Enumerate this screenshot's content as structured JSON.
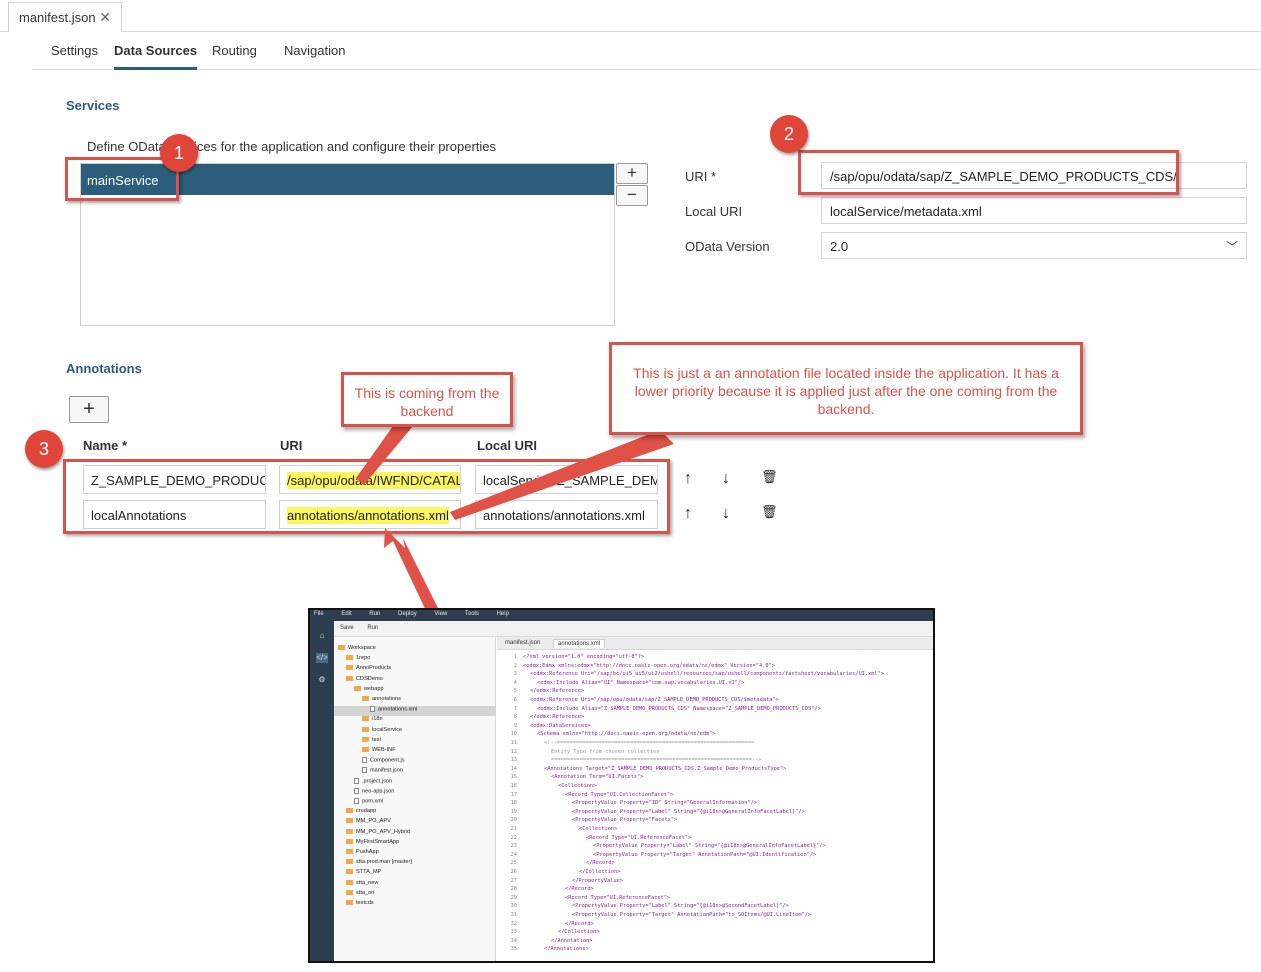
{
  "editor": {
    "file_tab": "manifest.json",
    "close_glyph": "✕"
  },
  "section_tabs": [
    "Settings",
    "Data Sources",
    "Routing",
    "Navigation"
  ],
  "services": {
    "heading": "Services",
    "description": "Define OData services for the application and configure their properties",
    "items": [
      "mainService"
    ],
    "add_label": "+",
    "remove_label": "−",
    "uri_label": "URI *",
    "uri_value": "/sap/opu/odata/sap/Z_SAMPLE_DEMO_PRODUCTS_CDS/",
    "local_uri_label": "Local URI",
    "local_uri_value": "localService/metadata.xml",
    "odata_version_label": "OData Version",
    "odata_version_value": "2.0"
  },
  "annotations": {
    "heading": "Annotations",
    "add_label": "+",
    "columns": [
      "Name *",
      "URI",
      "Local URI"
    ],
    "rows": [
      {
        "name": "Z_SAMPLE_DEMO_PRODUC",
        "uri": "/sap/opu/odata/IWFND/CATAL",
        "local_uri": "localService/Z_SAMPLE_DEM"
      },
      {
        "name": "localAnnotations",
        "uri": "annotations/annotations.xml",
        "local_uri": "annotations/annotations.xml"
      }
    ],
    "up_icon": "↑",
    "down_icon": "↓",
    "delete_icon": "🗑"
  },
  "callouts": {
    "badge_1": "1",
    "badge_2": "2",
    "badge_3": "3",
    "backend": "This is coming from the backend",
    "local": "This is just a an annotation file located inside the application. It has a lower priority because it is applied just after the one coming from the backend."
  },
  "colors": {
    "accent": "#2a5d7e",
    "selected_row": "#2c5e7c",
    "annotation_red": "#d9534a",
    "highlight": "#fbf75c"
  },
  "ide": {
    "menu": [
      "File",
      "Edit",
      "Run",
      "Deploy",
      "View",
      "Tools",
      "Help"
    ],
    "toolbar": [
      "Save",
      "Run"
    ],
    "tabs": [
      "manifest.json",
      "annotations.xml"
    ],
    "tree": [
      {
        "label": "Workspace",
        "depth": 0,
        "type": "folder"
      },
      {
        "label": "1repo",
        "depth": 1,
        "type": "folder"
      },
      {
        "label": "AnnoProducts",
        "depth": 1,
        "type": "folder"
      },
      {
        "label": "CDSDemo",
        "depth": 1,
        "type": "folder"
      },
      {
        "label": "webapp",
        "depth": 2,
        "type": "folder"
      },
      {
        "label": "annotations",
        "depth": 3,
        "type": "folder"
      },
      {
        "label": "annotations.xml",
        "depth": 4,
        "type": "doc",
        "selected": true
      },
      {
        "label": "i18n",
        "depth": 3,
        "type": "folder"
      },
      {
        "label": "localService",
        "depth": 3,
        "type": "folder"
      },
      {
        "label": "test",
        "depth": 3,
        "type": "folder"
      },
      {
        "label": "WEB-INF",
        "depth": 3,
        "type": "folder"
      },
      {
        "label": "Component.js",
        "depth": 3,
        "type": "doc"
      },
      {
        "label": "manifest.json",
        "depth": 3,
        "type": "doc"
      },
      {
        "label": ".project.json",
        "depth": 2,
        "type": "doc"
      },
      {
        "label": "neo-app.json",
        "depth": 2,
        "type": "doc"
      },
      {
        "label": "pom.xml",
        "depth": 2,
        "type": "doc"
      },
      {
        "label": "crudapp",
        "depth": 1,
        "type": "folder"
      },
      {
        "label": "MM_PO_APV",
        "depth": 1,
        "type": "folder"
      },
      {
        "label": "MM_PO_APV_Hybrid",
        "depth": 1,
        "type": "folder"
      },
      {
        "label": "MyFirstSmartApp",
        "depth": 1,
        "type": "folder"
      },
      {
        "label": "PushApp",
        "depth": 1,
        "type": "folder"
      },
      {
        "label": "stta.prod.man [master]",
        "depth": 1,
        "type": "folder"
      },
      {
        "label": "STTA_MP",
        "depth": 1,
        "type": "folder"
      },
      {
        "label": "stta_new",
        "depth": 1,
        "type": "folder"
      },
      {
        "label": "stta_ori",
        "depth": 1,
        "type": "folder"
      },
      {
        "label": "testcds",
        "depth": 1,
        "type": "folder"
      }
    ],
    "code": [
      {
        "n": "1",
        "indent": 0,
        "text": "<?xml version=\"1.0\" encoding=\"utf-8\"?>"
      },
      {
        "n": "2",
        "indent": 0,
        "text": "<edmx:Edmx xmlns:edmx=\"http://docs.oasis-open.org/odata/ns/edmx\" Version=\"4.0\">"
      },
      {
        "n": "3",
        "indent": 1,
        "text": "<edmx:Reference Uri=\"/sap/bc/ui5_ui5/ui2/ushell/resources/sap/ushell/components/factsheet/vocabularies/UI.xml\">"
      },
      {
        "n": "4",
        "indent": 2,
        "text": "<edmx:Include Alias=\"UI\" Namespace=\"com.sap.vocabularies.UI.v1\"/>"
      },
      {
        "n": "5",
        "indent": 1,
        "text": "</edmx:Reference>"
      },
      {
        "n": "6",
        "indent": 1,
        "text": "<edmx:Reference Uri=\"/sap/opu/odata/sap/Z_SAMPLE_DEMO_PRODUCTS_CDS/$metadata\">"
      },
      {
        "n": "7",
        "indent": 2,
        "text": "<edmx:Include Alias=\"Z_SAMPLE_DEMO_PRODUCTS_CDS\" Namespace=\"Z_SAMPLE_DEMO_PRODUCTS_CDS\"/>"
      },
      {
        "n": "8",
        "indent": 1,
        "text": "</edmx:Reference>"
      },
      {
        "n": "9",
        "indent": 1,
        "text": "<edmx:DataServices>"
      },
      {
        "n": "10",
        "indent": 2,
        "text": "<Schema xmlns=\"http://docs.oasis-open.org/odata/ns/edm\">"
      },
      {
        "n": "11",
        "indent": 3,
        "text": "<!--==============================================================",
        "gray": true
      },
      {
        "n": "12",
        "indent": 4,
        "text": "Entity Type from chosen collection",
        "gray": true
      },
      {
        "n": "13",
        "indent": 4,
        "text": "===============================================================-->",
        "gray": true
      },
      {
        "n": "14",
        "indent": 3,
        "text": "<Annotations Target=\"Z_SAMPLE_DEMO_PRODUCTS_CDS.Z_Sample_Demo_ProductsType\">"
      },
      {
        "n": "15",
        "indent": 4,
        "text": "<Annotation Term=\"UI.Facets\">"
      },
      {
        "n": "16",
        "indent": 5,
        "text": "<Collection>"
      },
      {
        "n": "17",
        "indent": 6,
        "text": "<Record Type=\"UI.CollectionFacet\">"
      },
      {
        "n": "18",
        "indent": 7,
        "text": "<PropertyValue Property=\"ID\" String=\"GeneralInformation\"/>"
      },
      {
        "n": "19",
        "indent": 7,
        "text": "<PropertyValue Property=\"Label\" String=\"{@i18n>@GeneralInfoFacetLabel}\"/>"
      },
      {
        "n": "20",
        "indent": 7,
        "text": "<PropertyValue Property=\"Facets\">"
      },
      {
        "n": "21",
        "indent": 8,
        "text": "<Collection>"
      },
      {
        "n": "22",
        "indent": 9,
        "text": "<Record Type=\"UI.ReferenceFacet\">"
      },
      {
        "n": "23",
        "indent": 10,
        "text": "<PropertyValue Property=\"Label\" String=\"{@i18n>@GeneralInfoFacetLabel}\"/>"
      },
      {
        "n": "24",
        "indent": 10,
        "text": "<PropertyValue Property=\"Target\" AnnotationPath=\"@UI.Identification\"/>"
      },
      {
        "n": "25",
        "indent": 9,
        "text": "</Record>"
      },
      {
        "n": "26",
        "indent": 8,
        "text": "</Collection>"
      },
      {
        "n": "27",
        "indent": 7,
        "text": "</PropertyValue>"
      },
      {
        "n": "28",
        "indent": 6,
        "text": "</Record>"
      },
      {
        "n": "29",
        "indent": 6,
        "text": "<Record Type=\"UI.ReferenceFacet\">"
      },
      {
        "n": "30",
        "indent": 7,
        "text": "<PropertyValue Property=\"Label\" String=\"{@i18n>@SecondFacetLabel}\"/>"
      },
      {
        "n": "31",
        "indent": 7,
        "text": "<PropertyValue Property=\"Target\" AnnotationPath=\"to_SOItems/@UI.LineItem\"/>"
      },
      {
        "n": "32",
        "indent": 6,
        "text": "</Record>"
      },
      {
        "n": "33",
        "indent": 5,
        "text": "</Collection>"
      },
      {
        "n": "34",
        "indent": 4,
        "text": "</Annotation>"
      },
      {
        "n": "35",
        "indent": 3,
        "text": "</Annotations>"
      }
    ]
  }
}
